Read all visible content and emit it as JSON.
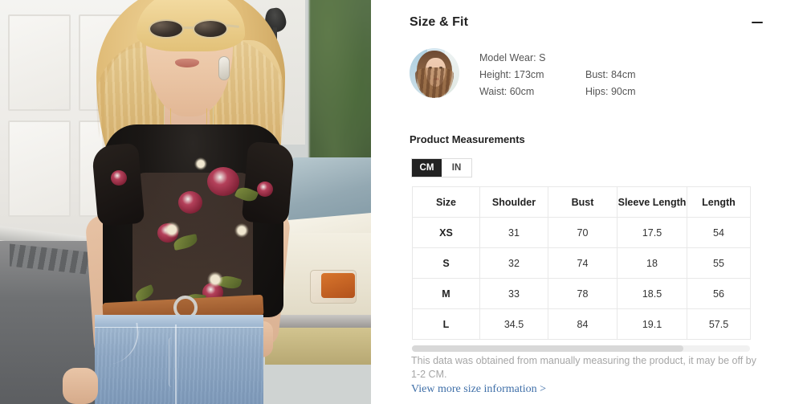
{
  "product_image": {
    "alt": "Model wearing black floral embroidered sheer mesh top with blue jeans and brown belt"
  },
  "section": {
    "title": "Size & Fit",
    "collapse_icon": "minus-icon",
    "expanded": true
  },
  "model_info": {
    "avatar_alt": "Model headshot",
    "model_wear_label": "Model Wear: S",
    "height_label": "Height: 173cm",
    "bust_label": "Bust: 84cm",
    "waist_label": "Waist: 60cm",
    "hips_label": "Hips: 90cm"
  },
  "measurements": {
    "title": "Product Measurements",
    "units": [
      {
        "label": "CM",
        "active": true
      },
      {
        "label": "IN",
        "active": false
      }
    ],
    "columns": [
      "Size",
      "Shoulder",
      "Bust",
      "Sleeve Length",
      "Length"
    ],
    "rows": [
      {
        "size": "XS",
        "shoulder": "31",
        "bust": "70",
        "sleeve_length": "17.5",
        "length": "54"
      },
      {
        "size": "S",
        "shoulder": "32",
        "bust": "74",
        "sleeve_length": "18",
        "length": "55"
      },
      {
        "size": "M",
        "shoulder": "33",
        "bust": "78",
        "sleeve_length": "18.5",
        "length": "56"
      },
      {
        "size": "L",
        "shoulder": "34.5",
        "bust": "84",
        "sleeve_length": "19.1",
        "length": "57.5"
      }
    ],
    "scrollbar": {
      "thumb_fraction": "0.80"
    },
    "disclaimer": "This data was obtained from manually measuring the product, it may be off by 1-2 CM.",
    "more_link": "View more size information >"
  },
  "colors": {
    "accent": "#222222",
    "link": "#3f6fa8",
    "text": "#333333",
    "muted": "#a6a6a6",
    "border": "#e8e8e8"
  }
}
